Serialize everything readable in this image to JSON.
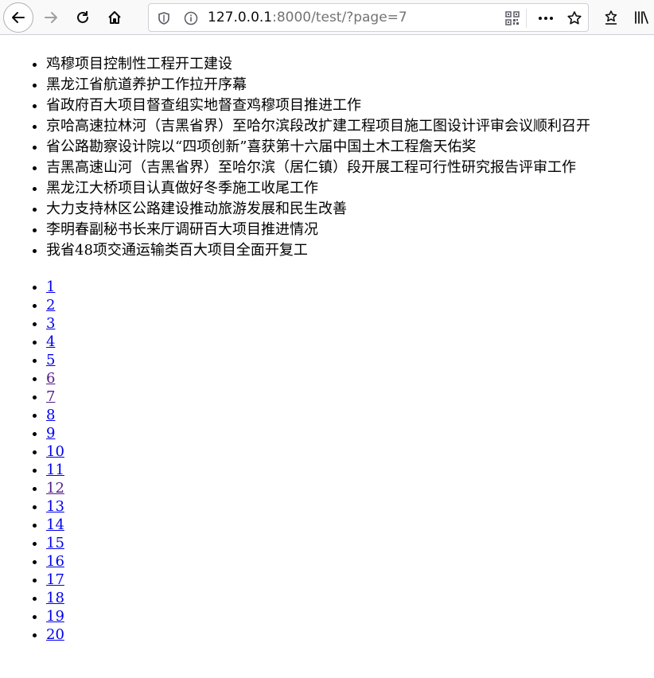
{
  "browser": {
    "url_host": "127.0.0.1",
    "url_rest": ":8000/test/?page=7"
  },
  "news": [
    "鸡穆项目控制性工程开工建设",
    "黑龙江省航道养护工作拉开序幕",
    "省政府百大项目督查组实地督查鸡穆项目推进工作",
    "京哈高速拉林河（吉黑省界）至哈尔滨段改扩建工程项目施工图设计评审会议顺利召开",
    "省公路勘察设计院以“四项创新”喜获第十六届中国土木工程詹天佑奖",
    "吉黑高速山河（吉黑省界）至哈尔滨（居仁镇）段开展工程可行性研究报告评审工作",
    "黑龙江大桥项目认真做好冬季施工收尾工作",
    "大力支持林区公路建设推动旅游发展和民生改善",
    "李明春副秘书长来厅调研百大项目推进情况",
    "我省48项交通运输类百大项目全面开复工"
  ],
  "pages": [
    "1",
    "2",
    "3",
    "4",
    "5",
    "6",
    "7",
    "8",
    "9",
    "10",
    "11",
    "12",
    "13",
    "14",
    "15",
    "16",
    "17",
    "18",
    "19",
    "20"
  ],
  "visited_pages": [
    "6",
    "7",
    "12"
  ],
  "colors": {
    "link": "#0000ee",
    "visited_link": "#551a8b"
  }
}
